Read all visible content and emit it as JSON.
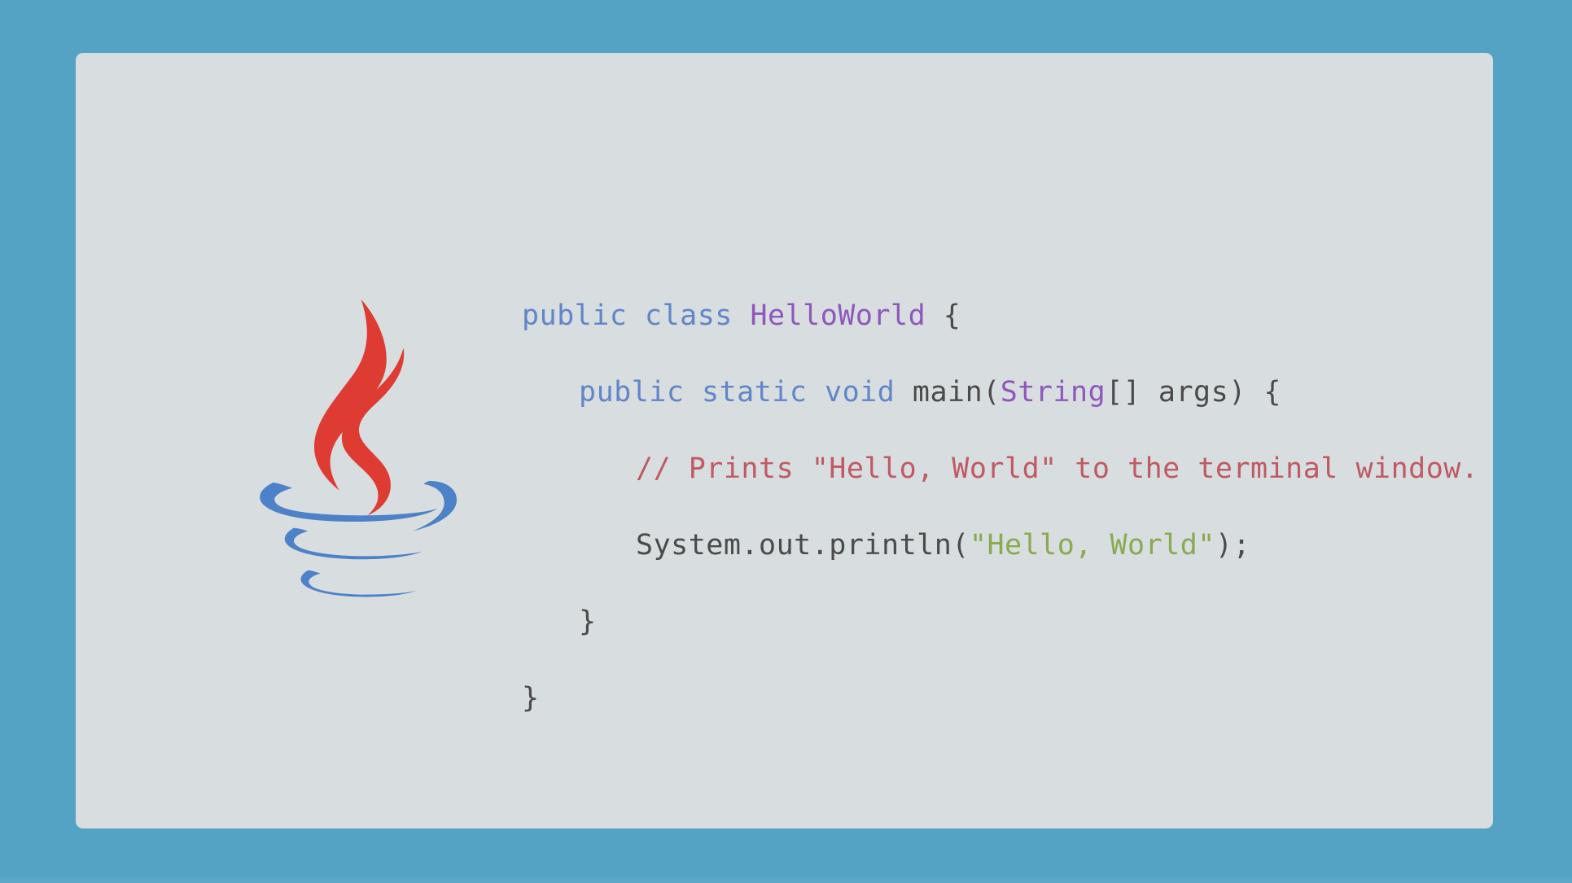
{
  "theme": {
    "page_background": "#55a3c4",
    "card_background": "#d8dde0",
    "keyword_color": "#6186c8",
    "type_color": "#8f57bd",
    "plain_color": "#4a4a4a",
    "comment_color": "#bf5a64",
    "string_color": "#89aa51",
    "logo_red": "#de3b33",
    "logo_blue": "#4d81c8"
  },
  "logo": {
    "name": "java-logo",
    "alt": "Java coffee cup logo"
  },
  "code": {
    "language": "java",
    "lines": [
      {
        "indent": 0,
        "tokens": [
          {
            "text": "public",
            "kind": "kw"
          },
          {
            "text": " ",
            "kind": "plain"
          },
          {
            "text": "class",
            "kind": "kw"
          },
          {
            "text": " ",
            "kind": "plain"
          },
          {
            "text": "HelloWorld",
            "kind": "type"
          },
          {
            "text": " {",
            "kind": "punct"
          }
        ]
      },
      {
        "indent": 1,
        "tokens": [
          {
            "text": "public",
            "kind": "kw"
          },
          {
            "text": " ",
            "kind": "plain"
          },
          {
            "text": "static",
            "kind": "kw"
          },
          {
            "text": " ",
            "kind": "plain"
          },
          {
            "text": "void",
            "kind": "kw"
          },
          {
            "text": " ",
            "kind": "plain"
          },
          {
            "text": "main(",
            "kind": "plain"
          },
          {
            "text": "String",
            "kind": "type"
          },
          {
            "text": "[] args) {",
            "kind": "plain"
          }
        ]
      },
      {
        "indent": 2,
        "tokens": [
          {
            "text": "// Prints \"Hello, World\" to the terminal window.",
            "kind": "comment"
          }
        ]
      },
      {
        "indent": 2,
        "tokens": [
          {
            "text": "System.out.println(",
            "kind": "plain"
          },
          {
            "text": "\"Hello, World\"",
            "kind": "string"
          },
          {
            "text": ");",
            "kind": "plain"
          }
        ]
      },
      {
        "indent": 1,
        "tokens": [
          {
            "text": "}",
            "kind": "punct"
          }
        ]
      },
      {
        "indent": 0,
        "tokens": [
          {
            "text": "}",
            "kind": "punct"
          }
        ]
      }
    ]
  }
}
